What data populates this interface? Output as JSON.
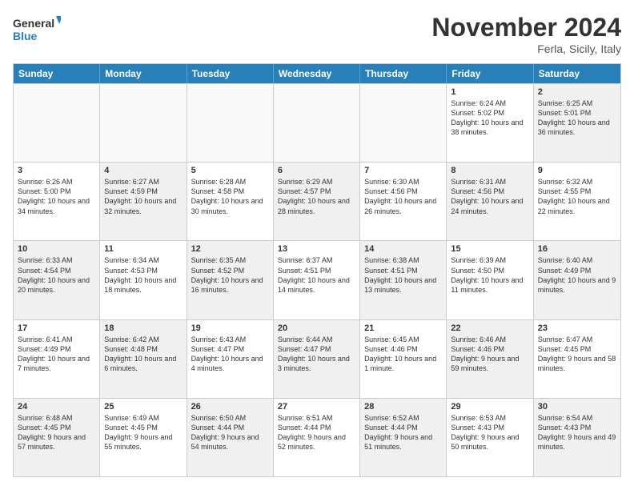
{
  "header": {
    "logo_line1": "General",
    "logo_line2": "Blue",
    "month_title": "November 2024",
    "location": "Ferla, Sicily, Italy"
  },
  "days_of_week": [
    "Sunday",
    "Monday",
    "Tuesday",
    "Wednesday",
    "Thursday",
    "Friday",
    "Saturday"
  ],
  "rows": [
    {
      "cells": [
        {
          "day": "",
          "info": "",
          "empty": true
        },
        {
          "day": "",
          "info": "",
          "empty": true
        },
        {
          "day": "",
          "info": "",
          "empty": true
        },
        {
          "day": "",
          "info": "",
          "empty": true
        },
        {
          "day": "",
          "info": "",
          "empty": true
        },
        {
          "day": "1",
          "info": "Sunrise: 6:24 AM\nSunset: 5:02 PM\nDaylight: 10 hours and 38 minutes.",
          "empty": false
        },
        {
          "day": "2",
          "info": "Sunrise: 6:25 AM\nSunset: 5:01 PM\nDaylight: 10 hours and 36 minutes.",
          "empty": false,
          "shaded": true
        }
      ]
    },
    {
      "cells": [
        {
          "day": "3",
          "info": "Sunrise: 6:26 AM\nSunset: 5:00 PM\nDaylight: 10 hours and 34 minutes.",
          "empty": false
        },
        {
          "day": "4",
          "info": "Sunrise: 6:27 AM\nSunset: 4:59 PM\nDaylight: 10 hours and 32 minutes.",
          "empty": false,
          "shaded": true
        },
        {
          "day": "5",
          "info": "Sunrise: 6:28 AM\nSunset: 4:58 PM\nDaylight: 10 hours and 30 minutes.",
          "empty": false
        },
        {
          "day": "6",
          "info": "Sunrise: 6:29 AM\nSunset: 4:57 PM\nDaylight: 10 hours and 28 minutes.",
          "empty": false,
          "shaded": true
        },
        {
          "day": "7",
          "info": "Sunrise: 6:30 AM\nSunset: 4:56 PM\nDaylight: 10 hours and 26 minutes.",
          "empty": false
        },
        {
          "day": "8",
          "info": "Sunrise: 6:31 AM\nSunset: 4:56 PM\nDaylight: 10 hours and 24 minutes.",
          "empty": false,
          "shaded": true
        },
        {
          "day": "9",
          "info": "Sunrise: 6:32 AM\nSunset: 4:55 PM\nDaylight: 10 hours and 22 minutes.",
          "empty": false
        }
      ]
    },
    {
      "cells": [
        {
          "day": "10",
          "info": "Sunrise: 6:33 AM\nSunset: 4:54 PM\nDaylight: 10 hours and 20 minutes.",
          "empty": false,
          "shaded": true
        },
        {
          "day": "11",
          "info": "Sunrise: 6:34 AM\nSunset: 4:53 PM\nDaylight: 10 hours and 18 minutes.",
          "empty": false
        },
        {
          "day": "12",
          "info": "Sunrise: 6:35 AM\nSunset: 4:52 PM\nDaylight: 10 hours and 16 minutes.",
          "empty": false,
          "shaded": true
        },
        {
          "day": "13",
          "info": "Sunrise: 6:37 AM\nSunset: 4:51 PM\nDaylight: 10 hours and 14 minutes.",
          "empty": false
        },
        {
          "day": "14",
          "info": "Sunrise: 6:38 AM\nSunset: 4:51 PM\nDaylight: 10 hours and 13 minutes.",
          "empty": false,
          "shaded": true
        },
        {
          "day": "15",
          "info": "Sunrise: 6:39 AM\nSunset: 4:50 PM\nDaylight: 10 hours and 11 minutes.",
          "empty": false
        },
        {
          "day": "16",
          "info": "Sunrise: 6:40 AM\nSunset: 4:49 PM\nDaylight: 10 hours and 9 minutes.",
          "empty": false,
          "shaded": true
        }
      ]
    },
    {
      "cells": [
        {
          "day": "17",
          "info": "Sunrise: 6:41 AM\nSunset: 4:49 PM\nDaylight: 10 hours and 7 minutes.",
          "empty": false
        },
        {
          "day": "18",
          "info": "Sunrise: 6:42 AM\nSunset: 4:48 PM\nDaylight: 10 hours and 6 minutes.",
          "empty": false,
          "shaded": true
        },
        {
          "day": "19",
          "info": "Sunrise: 6:43 AM\nSunset: 4:47 PM\nDaylight: 10 hours and 4 minutes.",
          "empty": false
        },
        {
          "day": "20",
          "info": "Sunrise: 6:44 AM\nSunset: 4:47 PM\nDaylight: 10 hours and 3 minutes.",
          "empty": false,
          "shaded": true
        },
        {
          "day": "21",
          "info": "Sunrise: 6:45 AM\nSunset: 4:46 PM\nDaylight: 10 hours and 1 minute.",
          "empty": false
        },
        {
          "day": "22",
          "info": "Sunrise: 6:46 AM\nSunset: 4:46 PM\nDaylight: 9 hours and 59 minutes.",
          "empty": false,
          "shaded": true
        },
        {
          "day": "23",
          "info": "Sunrise: 6:47 AM\nSunset: 4:45 PM\nDaylight: 9 hours and 58 minutes.",
          "empty": false
        }
      ]
    },
    {
      "cells": [
        {
          "day": "24",
          "info": "Sunrise: 6:48 AM\nSunset: 4:45 PM\nDaylight: 9 hours and 57 minutes.",
          "empty": false,
          "shaded": true
        },
        {
          "day": "25",
          "info": "Sunrise: 6:49 AM\nSunset: 4:45 PM\nDaylight: 9 hours and 55 minutes.",
          "empty": false
        },
        {
          "day": "26",
          "info": "Sunrise: 6:50 AM\nSunset: 4:44 PM\nDaylight: 9 hours and 54 minutes.",
          "empty": false,
          "shaded": true
        },
        {
          "day": "27",
          "info": "Sunrise: 6:51 AM\nSunset: 4:44 PM\nDaylight: 9 hours and 52 minutes.",
          "empty": false
        },
        {
          "day": "28",
          "info": "Sunrise: 6:52 AM\nSunset: 4:44 PM\nDaylight: 9 hours and 51 minutes.",
          "empty": false,
          "shaded": true
        },
        {
          "day": "29",
          "info": "Sunrise: 6:53 AM\nSunset: 4:43 PM\nDaylight: 9 hours and 50 minutes.",
          "empty": false
        },
        {
          "day": "30",
          "info": "Sunrise: 6:54 AM\nSunset: 4:43 PM\nDaylight: 9 hours and 49 minutes.",
          "empty": false,
          "shaded": true
        }
      ]
    }
  ]
}
